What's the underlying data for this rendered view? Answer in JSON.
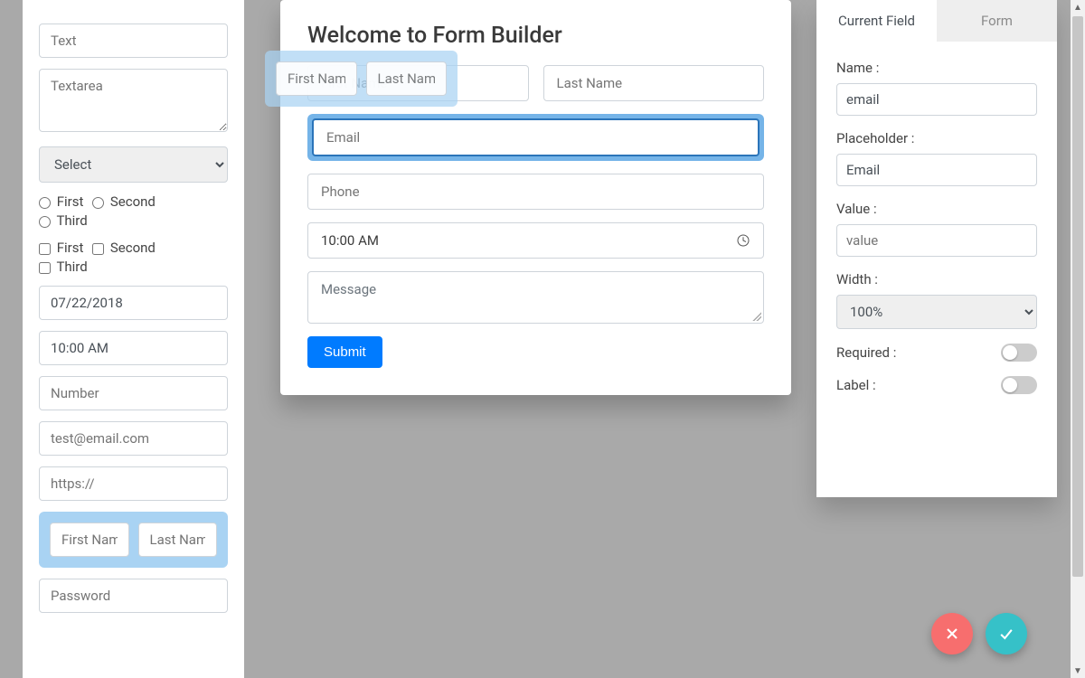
{
  "palette": {
    "text_ph": "Text",
    "textarea_ph": "Textarea",
    "select_label": "Select",
    "radio": [
      "First",
      "Second",
      "Third"
    ],
    "check": [
      "First",
      "Second",
      "Third"
    ],
    "date_value": "07/22/2018",
    "time_value": "10:00 AM",
    "number_ph": "Number",
    "email_ph": "test@email.com",
    "url_ph": "https://",
    "name_pair": {
      "first": "First Name",
      "last": "Last Name"
    },
    "password_ph": "Password"
  },
  "drag_ghost": {
    "first": "First Nam",
    "last": "Last Nam"
  },
  "canvas": {
    "title": "Welcome to Form Builder",
    "first_name_ph": "First Name",
    "last_name_ph": "Last Name",
    "email_ph": "Email",
    "phone_ph": "Phone",
    "time_value": "10:00 AM",
    "message_ph": "Message",
    "submit_label": "Submit"
  },
  "props": {
    "tab_current": "Current Field",
    "tab_form": "Form",
    "name_label": "Name :",
    "name_value": "email",
    "placeholder_label": "Placeholder :",
    "placeholder_value": "Email",
    "value_label": "Value :",
    "value_ph": "value",
    "width_label": "Width :",
    "width_value": "100%",
    "required_label": "Required :",
    "label_label": "Label :"
  }
}
